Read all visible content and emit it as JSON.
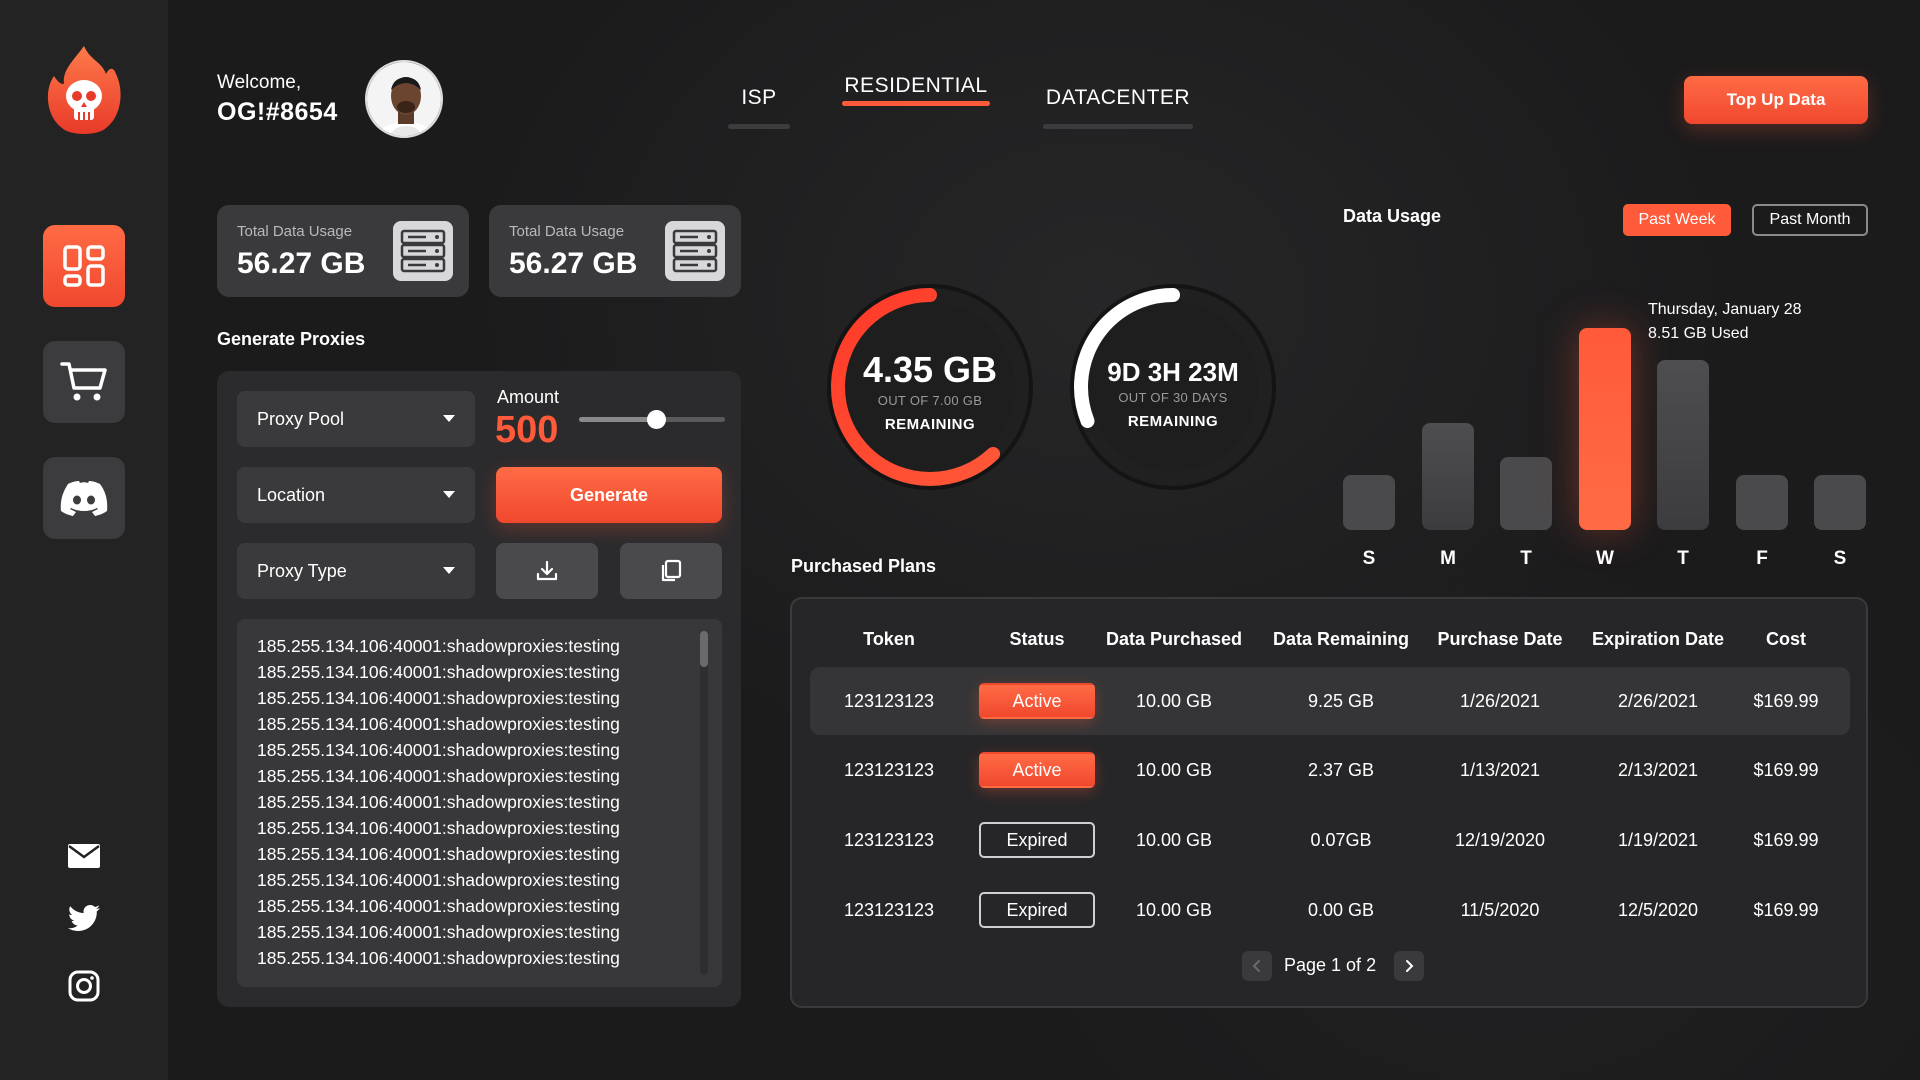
{
  "header": {
    "welcome": "Welcome,",
    "username": "OG!#8654",
    "tabs": [
      {
        "label": "ISP",
        "active": false
      },
      {
        "label": "RESIDENTIAL",
        "active": true
      },
      {
        "label": "DATACENTER",
        "active": false
      }
    ],
    "topup_label": "Top Up Data"
  },
  "sidebar": {
    "items": [
      "dashboard-icon",
      "cart-icon",
      "discord-icon"
    ],
    "socials": [
      "mail-icon",
      "twitter-icon",
      "instagram-icon"
    ]
  },
  "stats": [
    {
      "label": "Total Data Usage",
      "value": "56.27 GB"
    },
    {
      "label": "Total Data Usage",
      "value": "56.27 GB"
    }
  ],
  "generate": {
    "title": "Generate Proxies",
    "proxy_pool": "Proxy Pool",
    "location": "Location",
    "proxy_type": "Proxy Type",
    "amount_label": "Amount",
    "amount_value": "500",
    "slider_fraction": 0.53,
    "generate_label": "Generate",
    "proxies": [
      "185.255.134.106:40001:shadowproxies:testing",
      "185.255.134.106:40001:shadowproxies:testing",
      "185.255.134.106:40001:shadowproxies:testing",
      "185.255.134.106:40001:shadowproxies:testing",
      "185.255.134.106:40001:shadowproxies:testing",
      "185.255.134.106:40001:shadowproxies:testing",
      "185.255.134.106:40001:shadowproxies:testing",
      "185.255.134.106:40001:shadowproxies:testing",
      "185.255.134.106:40001:shadowproxies:testing",
      "185.255.134.106:40001:shadowproxies:testing",
      "185.255.134.106:40001:shadowproxies:testing",
      "185.255.134.106:40001:shadowproxies:testing",
      "185.255.134.106:40001:shadowproxies:testing"
    ]
  },
  "gauges": [
    {
      "main": "4.35 GB",
      "sub": "OUT OF 7.00 GB",
      "remaining": "REMAINING",
      "fraction": 0.62
    },
    {
      "main": "9D 3H 23M",
      "sub": "OUT OF 30 DAYS",
      "remaining": "REMAINING",
      "fraction": 0.31
    }
  ],
  "usage": {
    "title": "Data Usage",
    "past_week": "Past Week",
    "past_month": "Past Month",
    "tooltip_date": "Thursday, January 28",
    "tooltip_value": "8.51 GB Used",
    "days": [
      "S",
      "M",
      "T",
      "W",
      "T",
      "F",
      "S"
    ],
    "levels": [
      0.27,
      0.53,
      0.36,
      1.0,
      0.84,
      0.27,
      0.27
    ],
    "highlight_index": 3
  },
  "plans": {
    "title": "Purchased Plans",
    "columns": [
      "Token",
      "Status",
      "Data Purchased",
      "Data Remaining",
      "Purchase Date",
      "Expiration Date",
      "Cost"
    ],
    "rows": [
      {
        "token": "123123123",
        "status": "Active",
        "purchased": "10.00 GB",
        "remaining": "9.25 GB",
        "purchase_date": "1/26/2021",
        "expiration_date": "2/26/2021",
        "cost": "$169.99"
      },
      {
        "token": "123123123",
        "status": "Active",
        "purchased": "10.00 GB",
        "remaining": "2.37 GB",
        "purchase_date": "1/13/2021",
        "expiration_date": "2/13/2021",
        "cost": "$169.99"
      },
      {
        "token": "123123123",
        "status": "Expired",
        "purchased": "10.00 GB",
        "remaining": "0.07GB",
        "purchase_date": "12/19/2020",
        "expiration_date": "1/19/2021",
        "cost": "$169.99"
      },
      {
        "token": "123123123",
        "status": "Expired",
        "purchased": "10.00 GB",
        "remaining": "0.00 GB",
        "purchase_date": "11/5/2020",
        "expiration_date": "12/5/2020",
        "cost": "$169.99"
      }
    ],
    "page_text": "Page 1 of 2"
  },
  "colors": {
    "accent": "#ff5a3a",
    "panel": "#2b2b2d",
    "background": "#1b1b1c"
  }
}
